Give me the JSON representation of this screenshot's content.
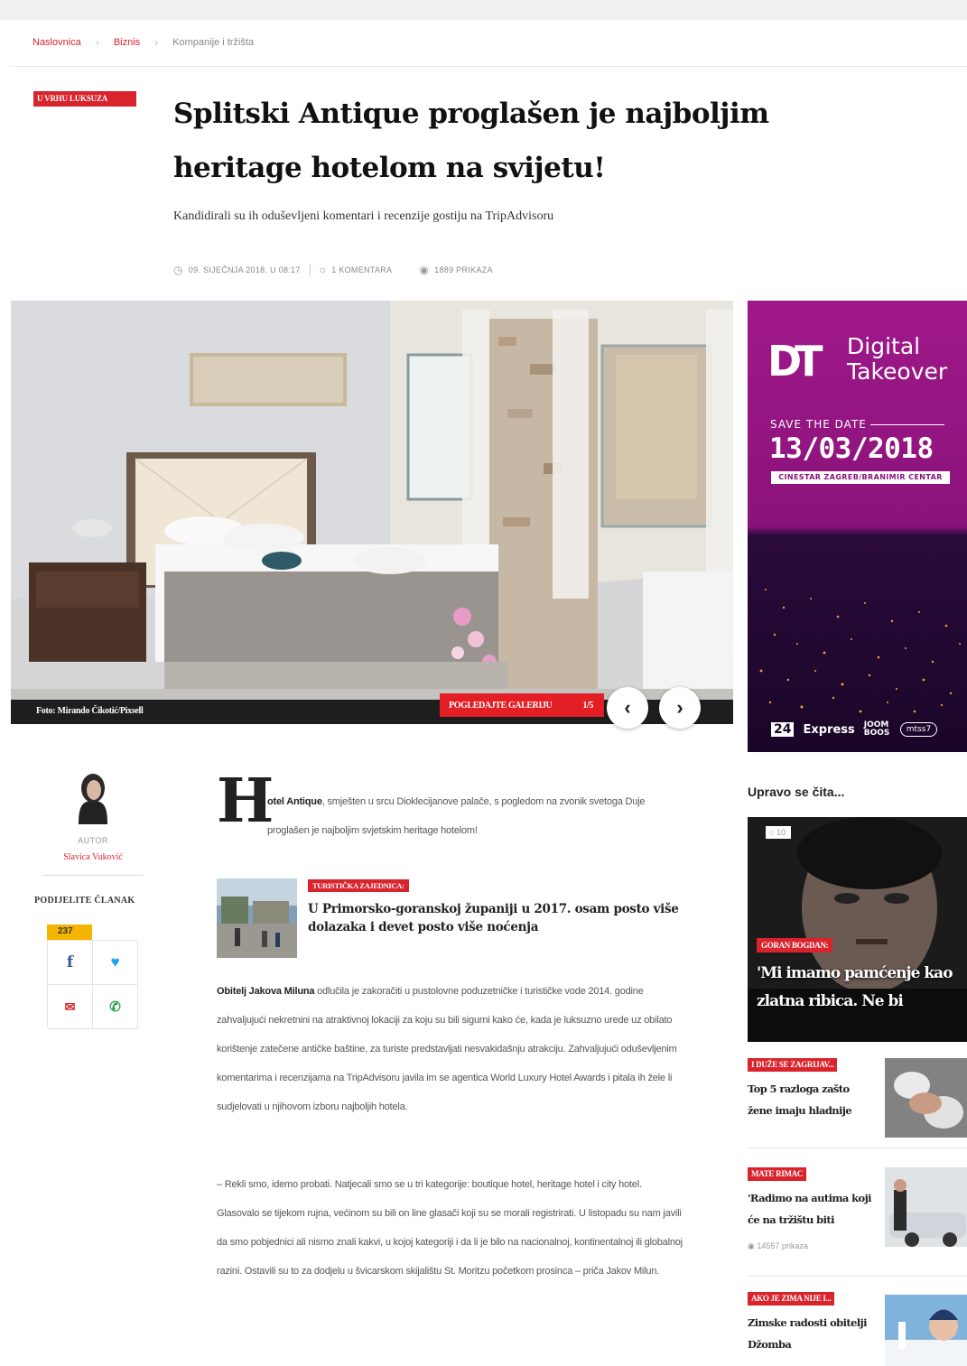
{
  "breadcrumb": {
    "items": [
      "Naslovnica",
      "Biznis",
      "Kompanije i tržišta"
    ]
  },
  "article": {
    "badge": "U VRHU LUKSUZA",
    "title": "Splitski Antique proglašen je najboljim heritage hotelom na svijetu!",
    "subtitle": "Kandidirali su ih oduševljeni komentari i recenzije gostiju na TripAdvisoru",
    "date": "09. SIJEČNJA 2018. U 08:17",
    "comments": "1 KOMENTARA",
    "views": "1889 PRIKAZA",
    "photo_credit": "Foto: Mirando Čikotić/Pixsell",
    "gallery_label": "POGLEDAJTE GALERIJU",
    "gallery_count": "1/5",
    "author_role": "AUTOR",
    "author_name": "Slavica Vuković",
    "share_title": "PODIJELITE ČLANAK",
    "share_count": "237",
    "dropcap": "H",
    "lead_bold": "otel Antique",
    "lead_rest": ", smješten u srcu Dioklecijanove palače, s pogledom na zvonik svetoga Duje proglašen je najboljim svjetskim heritage hotelom!",
    "p1_bold": "Obitelj Jakova Miluna",
    "p1_rest": " odlučila je zakoračiti u pustolovne poduzetničke i turističke vode 2014. godine zahvaljujući nekretnini na atraktivnoj lokaciji za koju su bili sigurni kako će, kada je luksuzno urede uz obilato korištenje zatečene antičke baštine, za turiste predstavljati nesvakidašnju atrakciju. Zahvaljujući oduševljenim komentarima i recenzijama na TripAdvisoru javila im se agentica World Luxury Hotel Awards i pitala ih žele li sudjelovati u njihovom izboru najboljih hotela.",
    "p2": "– Rekli smo, idemo probati. Natjecali smo se u tri kategorije: boutique hotel, heritage hotel i city hotel. Glasovalo se tijekom rujna, većinom su bili on line glasači koji su se morali registrirati. U listopadu su nam javili da smo pobjednici ali nismo znali kakvi, u kojoj kategoriji i da li je bilo na nacionalnoj, kontinentalnoj ili globalnoj razini. Ostavili su to za dodjelu u švicarskom skijalištu St. Moritzu početkom prosinca – priča Jakov Milun."
  },
  "related": {
    "tag": "TURISTIČKA ZAJEDNICA:",
    "title": "U Primorsko-goranskoj županiji u 2017. osam posto više dolazaka i devet posto više noćenja"
  },
  "ad": {
    "logo_mark": "DT",
    "logo_line1": "Digital",
    "logo_line2": "Takeover",
    "save_the_date": "SAVE THE DATE",
    "date": "13/03/2018",
    "venue": "CINESTAR ZAGREB/BRANIMIR CENTAR",
    "sponsor1": "24",
    "sponsor2": "Express",
    "sponsor3": "JOOM BOOS",
    "sponsor4": "mtss7"
  },
  "sidebar": {
    "heading": "Upravo se čita...",
    "featured": {
      "comments": "10",
      "tag": "GORAN BOGDAN:",
      "title": "'Mi imamo pamćenje kao zlatna ribica. Ne bi"
    },
    "items": [
      {
        "tag": "I DUŽE SE ZAGRIJAV...",
        "title": "Top 5 razloga zašto žene imaju hladnije",
        "views": ""
      },
      {
        "tag": "MATE RIMAC",
        "title": "'Radimo na autima koji će na tržištu biti",
        "views": "14557 prikaza"
      },
      {
        "tag": "AKO JE ZIMA NIJE I...",
        "title": "Zimske radosti obitelji Džomba",
        "views": ""
      }
    ]
  },
  "colors": {
    "accent": "#d9232d",
    "gallery": "#e31e24",
    "share_count_bg": "#f4b400",
    "ad_magenta": "#a0188a"
  }
}
